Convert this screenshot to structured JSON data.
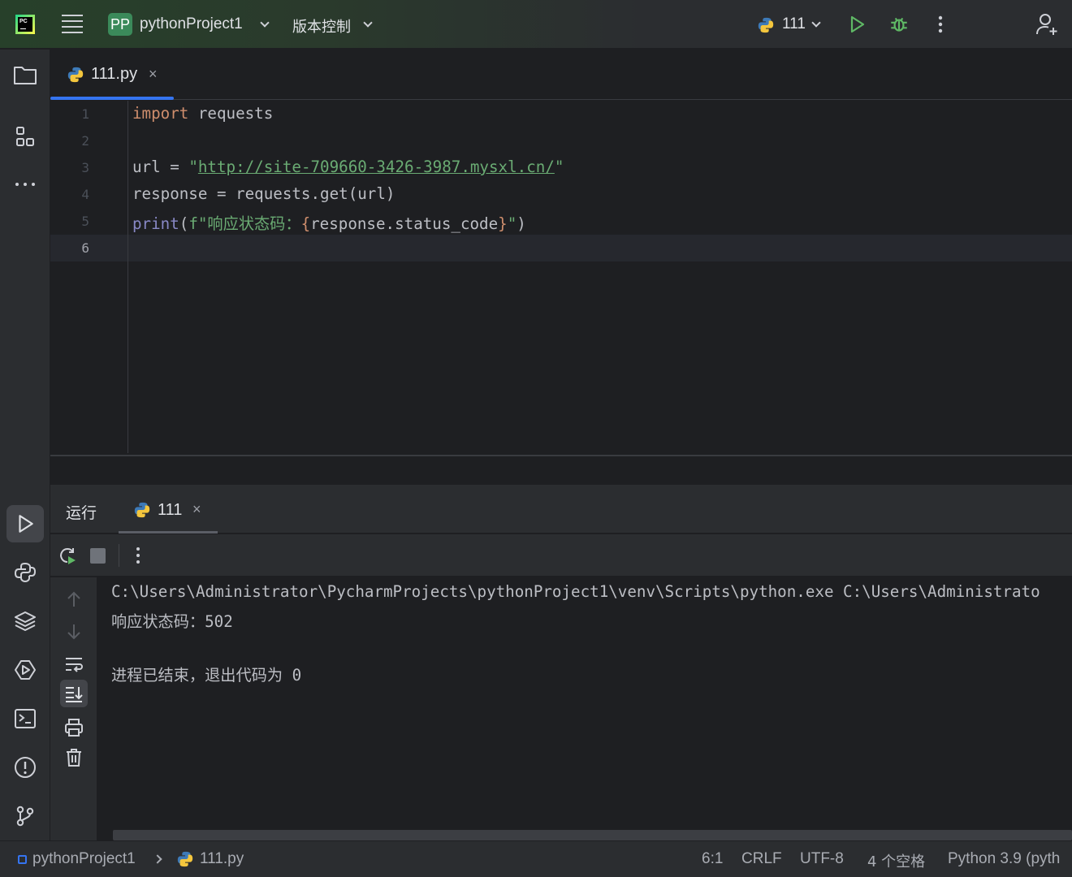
{
  "titlebar": {
    "project_badge": "PP",
    "project_name": "pythonProject1",
    "vcs_menu": "版本控制",
    "run_config": "111"
  },
  "editor": {
    "tab_label": "111.py",
    "line_numbers": [
      "1",
      "2",
      "3",
      "4",
      "5",
      "6"
    ],
    "code": {
      "l1_kw": "import",
      "l1_rest": " requests",
      "l3_var": "url = ",
      "l3_q1": "\"",
      "l3_url": "http://site-709660-3426-3987.mysxl.cn/",
      "l3_q2": "\"",
      "l4": "response = requests.get(url)",
      "l5_fn": "print",
      "l5_open": "(",
      "l5_fstr": "f\"响应状态码：",
      "l5_lb": "{",
      "l5_expr": "response.status_code",
      "l5_rb": "}",
      "l5_end_str": "\"",
      "l5_close": ")"
    }
  },
  "run_panel": {
    "title": "运行",
    "tab_label": "111",
    "console_lines": [
      "C:\\Users\\Administrator\\PycharmProjects\\pythonProject1\\venv\\Scripts\\python.exe C:\\Users\\Administrato",
      "响应状态码：502",
      "",
      "进程已结束，退出代码为 0"
    ]
  },
  "statusbar": {
    "project": "pythonProject1",
    "file": "111.py",
    "position": "6:1",
    "line_sep": "CRLF",
    "encoding": "UTF-8",
    "indent": "4 个空格",
    "interpreter": "Python 3.9 (pyth"
  },
  "colors": {
    "accent": "#3574f0",
    "run_green": "#5fb865",
    "keyword": "#cf8e6d",
    "string": "#6aab73"
  },
  "icons": [
    "pycharm-logo",
    "main-menu-icon",
    "run-icon",
    "debug-icon",
    "more-icon",
    "add-user-icon",
    "folder-icon",
    "structure-icon",
    "more-tools-icon",
    "run-tool-icon",
    "python-console-icon",
    "layers-icon",
    "services-icon",
    "terminal-icon",
    "problems-icon",
    "git-icon",
    "rerun-icon",
    "stop-icon",
    "up-arrow-icon",
    "down-arrow-icon",
    "soft-wrap-icon",
    "scroll-to-end-icon",
    "print-icon",
    "trash-icon",
    "python-file-icon",
    "close-icon"
  ]
}
